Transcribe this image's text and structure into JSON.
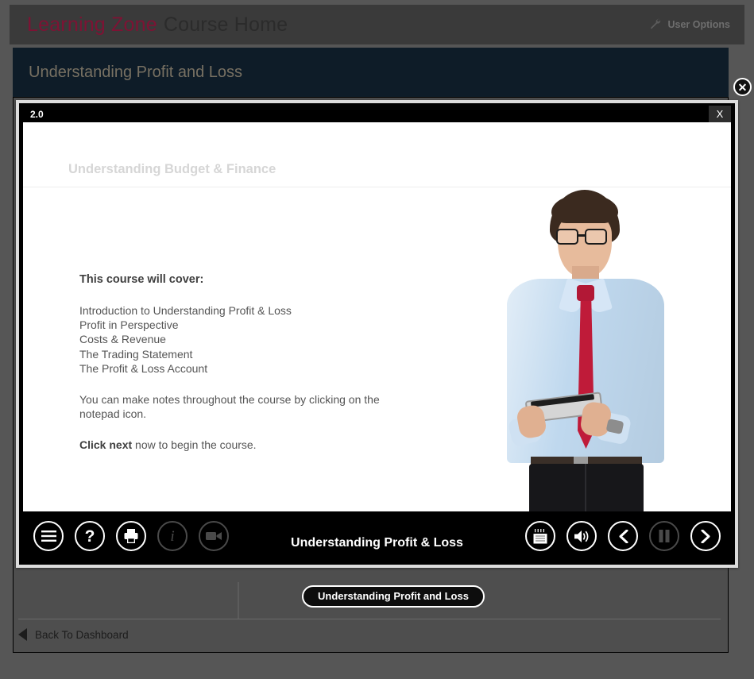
{
  "header": {
    "brand_zone": "Learning Zone",
    "brand_page": "Course Home",
    "user_options_label": "User Options",
    "wrench_icon": "wrench-icon"
  },
  "course_band": {
    "title": "Understanding Profit and Loss"
  },
  "page_close": {
    "glyph": "✕",
    "icon": "close-circle-icon"
  },
  "modal": {
    "version_label": "2.0",
    "close_glyph": "X",
    "stage_heading": "Understanding Budget & Finance",
    "content": {
      "heading": "This course will cover:",
      "topics": [
        "Introduction to Understanding Profit & Loss",
        "Profit in Perspective",
        "Costs & Revenue",
        "The Trading Statement",
        "The Profit & Loss Account"
      ],
      "topics_text": "Introduction to Understanding Profit & Loss\nProfit in Perspective\nCosts & Revenue\nThe Trading Statement\nThe Profit & Loss Account",
      "note": "You can make notes throughout the course by clicking on the notepad icon.",
      "cta_bold": "Click next",
      "cta_rest": " now to begin the course."
    },
    "toolbar": {
      "title": "Understanding Profit & Loss",
      "left_buttons": [
        {
          "name": "menu-icon",
          "label": "Menu",
          "enabled": true
        },
        {
          "name": "help-icon",
          "label": "Help",
          "enabled": true
        },
        {
          "name": "print-icon",
          "label": "Print",
          "enabled": true
        },
        {
          "name": "info-icon",
          "label": "Information",
          "enabled": false
        },
        {
          "name": "video-camera-icon",
          "label": "Video",
          "enabled": false
        }
      ],
      "right_buttons": [
        {
          "name": "notepad-icon",
          "label": "Notepad",
          "enabled": true
        },
        {
          "name": "volume-icon",
          "label": "Volume",
          "enabled": true
        },
        {
          "name": "previous-icon",
          "label": "Previous",
          "enabled": true
        },
        {
          "name": "pause-icon",
          "label": "Pause",
          "enabled": false
        },
        {
          "name": "next-icon",
          "label": "Next",
          "enabled": true
        }
      ]
    }
  },
  "page_body": {
    "course_pill_label": "Understanding Profit and Loss",
    "back_link_label": "Back To Dashboard",
    "back_icon": "back-triangle-icon"
  },
  "colors": {
    "brand_crimson": "#7d1334",
    "navy_band": "#0e1c28",
    "page_bg": "#565656",
    "header_bg": "#3a3a3a",
    "toolbar_bg": "#000000",
    "tie_red": "#bf1b39",
    "shirt_blue": "#bfd8ee"
  }
}
